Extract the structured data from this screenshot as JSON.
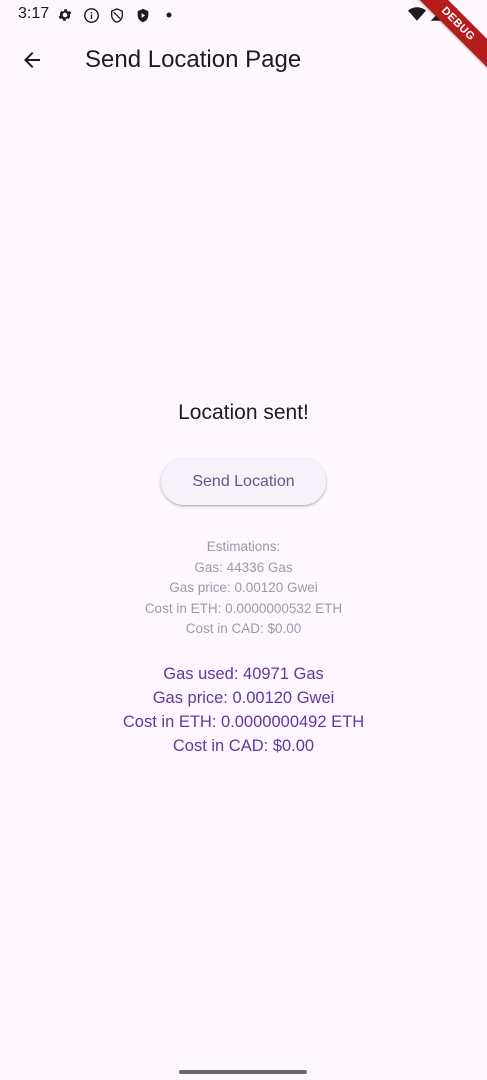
{
  "status_bar": {
    "time": "3:17",
    "left_icons": [
      "settings-gear-icon",
      "info-icon",
      "shield-icon",
      "shield-play-icon",
      "dot-icon"
    ],
    "right_icons": [
      "wifi-icon",
      "cell-signal-icon",
      "battery-icon"
    ]
  },
  "debug_banner": "DEBUG",
  "app_bar": {
    "title": "Send Location Page",
    "back_icon": "arrow-back-icon"
  },
  "main": {
    "status_message": "Location sent!",
    "send_button_label": "Send Location",
    "estimations": {
      "heading": "Estimations:",
      "gas": "Gas: 44336 Gas",
      "gas_price": "Gas price: 0.00120 Gwei",
      "cost_eth": "Cost in ETH: 0.0000000532 ETH",
      "cost_cad": "Cost in CAD: $0.00"
    },
    "actuals": {
      "gas_used": "Gas used: 40971 Gas",
      "gas_price": "Gas price: 0.00120 Gwei",
      "cost_eth": "Cost in ETH: 0.0000000492 ETH",
      "cost_cad": "Cost in CAD: $0.00"
    }
  },
  "colors": {
    "background": "#FEF7FF",
    "primary": "#65558F",
    "accent_text": "#6237A0",
    "muted_text": "#9E9AA2",
    "debug_banner": "#B71C1C"
  }
}
